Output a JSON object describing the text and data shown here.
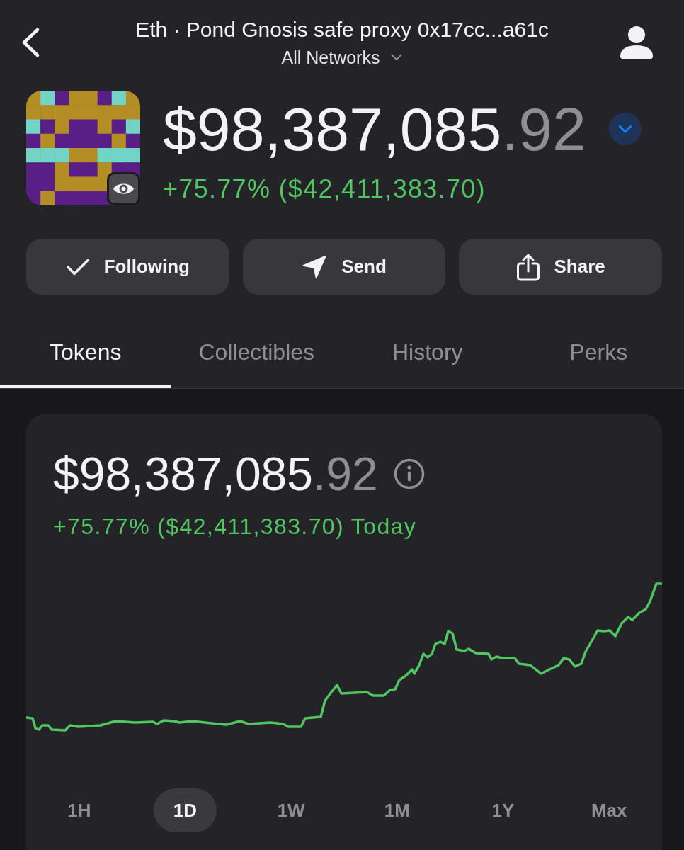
{
  "header": {
    "title": "Eth · Pond Gnosis safe proxy 0x17cc...a61c",
    "network": "All Networks"
  },
  "balance": {
    "amount": "$98,387,085",
    "cents": ".92",
    "change": "+75.77% ($42,411,383.70)"
  },
  "actions": [
    {
      "kind": "following",
      "label": "Following"
    },
    {
      "kind": "send",
      "label": "Send"
    },
    {
      "kind": "share",
      "label": "Share"
    }
  ],
  "tabs": [
    {
      "label": "Tokens",
      "selected": true
    },
    {
      "label": "Collectibles",
      "selected": false
    },
    {
      "label": "History",
      "selected": false
    },
    {
      "label": "Perks",
      "selected": false
    }
  ],
  "chart_card": {
    "amount": "$98,387,085",
    "cents": ".92",
    "change": "+75.77% ($42,411,383.70) Today",
    "ranges": [
      {
        "label": "1H",
        "selected": false
      },
      {
        "label": "1D",
        "selected": true
      },
      {
        "label": "1W",
        "selected": false
      },
      {
        "label": "1M",
        "selected": false
      },
      {
        "label": "1Y",
        "selected": false
      },
      {
        "label": "Max",
        "selected": false
      }
    ]
  }
}
